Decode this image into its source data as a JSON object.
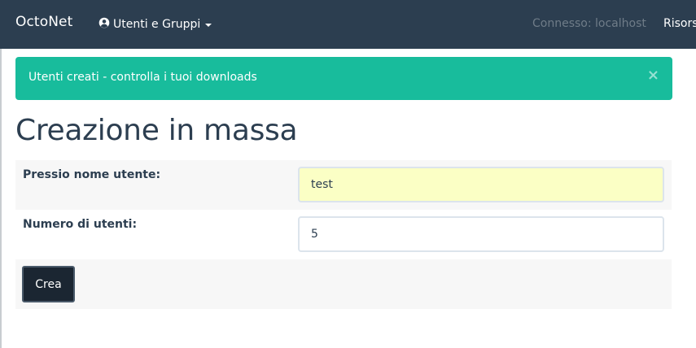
{
  "navbar": {
    "brand": "OctoNet",
    "users_menu_label": "Utenti e Gruppi",
    "users_menu_icon": "user-circle-icon",
    "connection_status": "Connesso: localhost",
    "resources_label": "Risorse"
  },
  "alert": {
    "message": "Utenti creati - controlla i tuoi downloads",
    "close_symbol": "×",
    "color": "#18bc9c"
  },
  "page": {
    "title": "Creazione in massa"
  },
  "form": {
    "prefix_label": "Pressio nome utente:",
    "prefix_value": "test",
    "count_label": "Numero di utenti:",
    "count_value": "5",
    "submit_label": "Crea"
  },
  "colors": {
    "navbar": "#2c3e50",
    "success": "#18bc9c",
    "autofill": "#fbffc5",
    "button": "#1b2632"
  }
}
